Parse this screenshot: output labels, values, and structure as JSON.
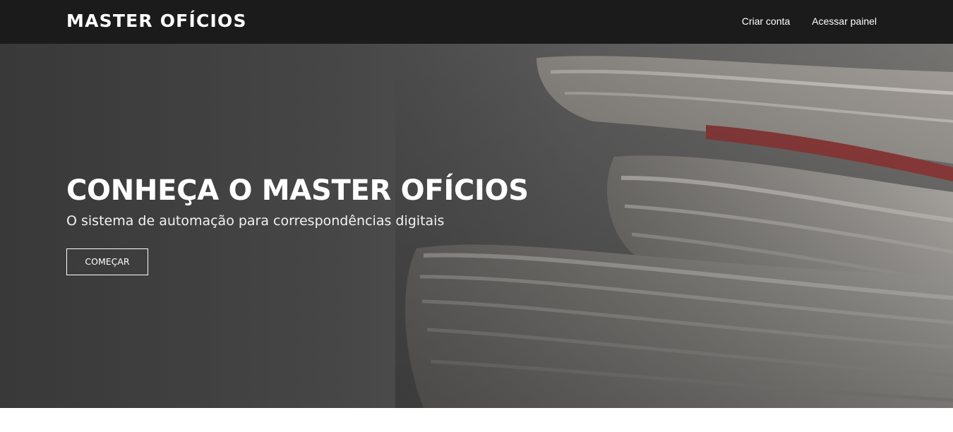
{
  "navbar": {
    "brand": "MASTER OFÍCIOS",
    "links": [
      {
        "label": "Criar conta"
      },
      {
        "label": "Acessar painel"
      }
    ],
    "background": "#1b1b1b"
  },
  "hero": {
    "title": "CONHEÇA O MASTER OFÍCIOS",
    "subtitle": "O sistema de automação para correspondências digitais",
    "cta_label": "COMEÇAR",
    "background_image": "stacked-newspapers"
  }
}
